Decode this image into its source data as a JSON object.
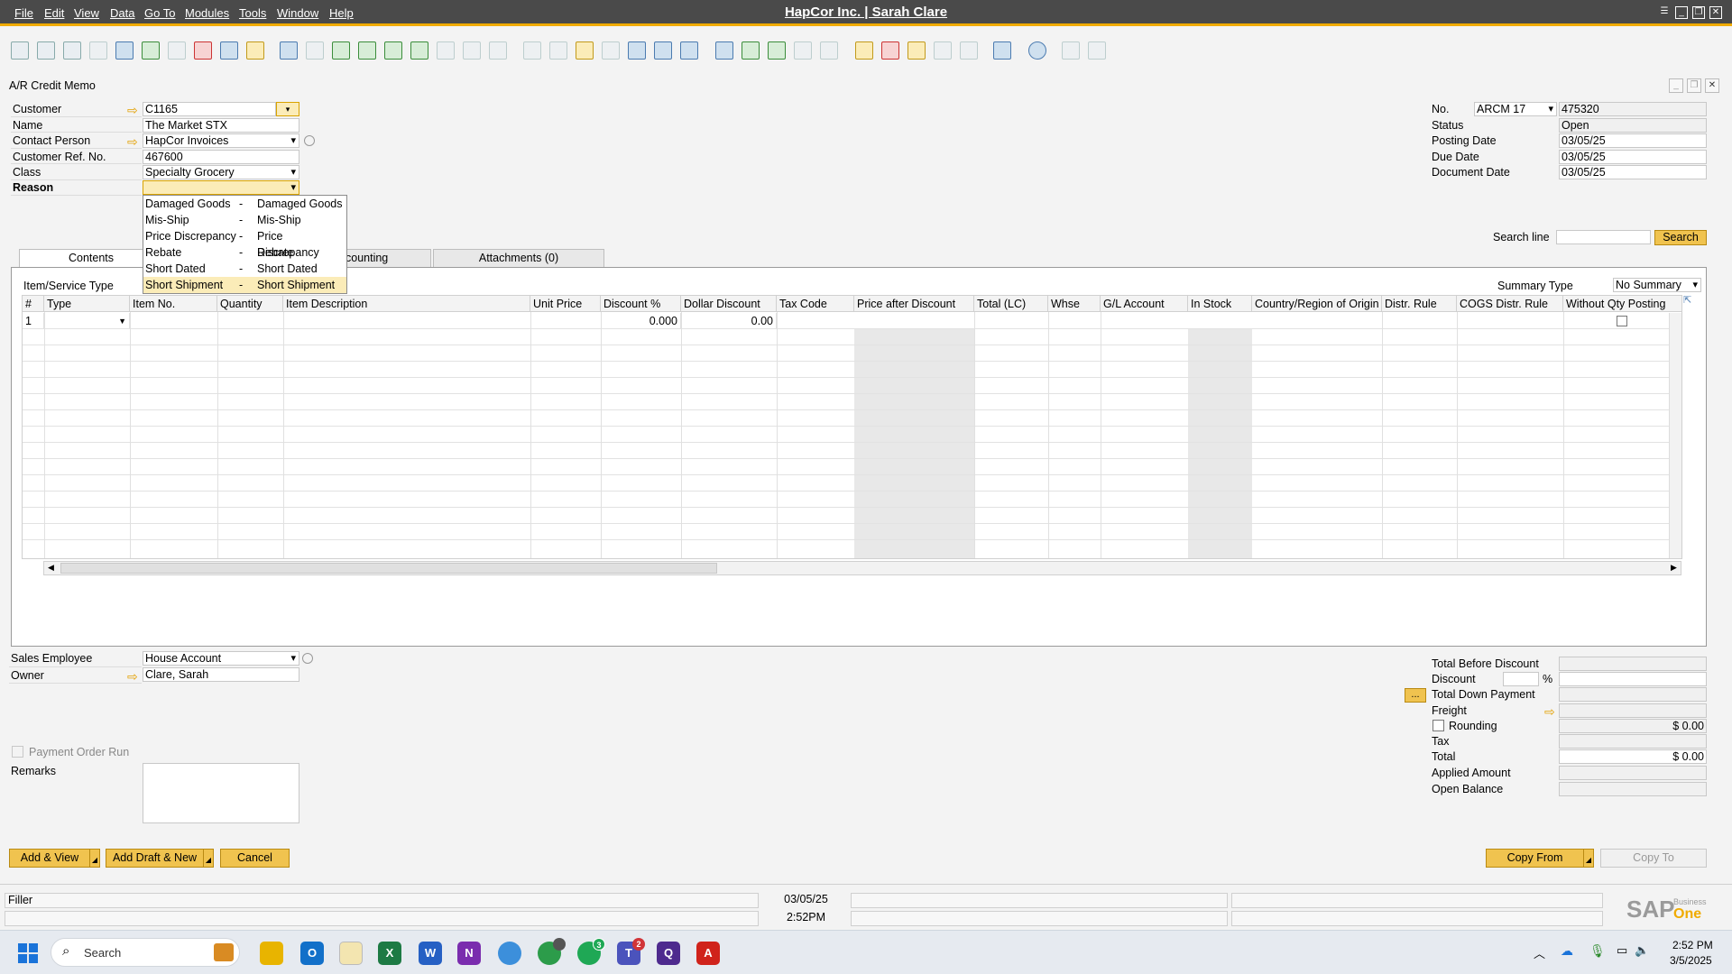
{
  "app": {
    "title": "HapCor Inc. | Sarah Clare",
    "menu": [
      "File",
      "Edit",
      "View",
      "Data",
      "Go To",
      "Modules",
      "Tools",
      "Window",
      "Help"
    ]
  },
  "window": {
    "title": "A/R Credit Memo"
  },
  "header_left": {
    "labels": {
      "customer": "Customer",
      "name": "Name",
      "contact": "Contact Person",
      "ref": "Customer Ref. No.",
      "class": "Class",
      "reason": "Reason"
    },
    "values": {
      "customer": "C1165",
      "name": "The Market STX",
      "contact": "HapCor Invoices",
      "ref": "467600",
      "class": "Specialty Grocery",
      "reason": ""
    }
  },
  "reason_options": [
    {
      "code": "Damaged Goods",
      "name": "Damaged Goods",
      "sep": "-"
    },
    {
      "code": "Mis-Ship",
      "name": "Mis-Ship",
      "sep": "-"
    },
    {
      "code": "Price Discrepancy",
      "name": "Price Discrepancy",
      "sep": "-"
    },
    {
      "code": "Rebate",
      "name": "Rebate",
      "sep": "-"
    },
    {
      "code": "Short Dated",
      "name": "Short Dated",
      "sep": "-"
    },
    {
      "code": "Short Shipment",
      "name": "Short Shipment",
      "sep": "-"
    }
  ],
  "header_right": {
    "labels": {
      "no": "No.",
      "status": "Status",
      "posting": "Posting Date",
      "due": "Due Date",
      "doc": "Document Date"
    },
    "values": {
      "series": "ARCM 17",
      "no": "475320",
      "status": "Open",
      "posting": "03/05/25",
      "due": "03/05/25",
      "doc": "03/05/25"
    }
  },
  "search": {
    "label": "Search line",
    "button": "Search",
    "value": ""
  },
  "tabs": [
    "Contents",
    "counting",
    "Attachments (0)"
  ],
  "contents": {
    "item_service_type": "Item/Service Type",
    "summary_type_label": "Summary Type",
    "summary_type_value": "No Summary"
  },
  "grid": {
    "columns": [
      "#",
      "Type",
      "Item No.",
      "Quantity",
      "Item Description",
      "Unit Price",
      "Discount %",
      "Dollar Discount",
      "Tax Code",
      "Price after Discount",
      "Total (LC)",
      "Whse",
      "G/L Account",
      "In Stock",
      "Country/Region of Origin",
      "Distr. Rule",
      "COGS Distr. Rule",
      "Without Qty Posting"
    ],
    "row1": {
      "num": "1",
      "discount_pct": "0.000",
      "dollar_discount": "0.00"
    }
  },
  "footer_left": {
    "sales_employee_label": "Sales Employee",
    "sales_employee": "House Account",
    "owner_label": "Owner",
    "owner": "Clare, Sarah",
    "payment_order_run": "Payment Order Run",
    "remarks_label": "Remarks"
  },
  "totals": {
    "labels": {
      "before": "Total Before Discount",
      "discount": "Discount",
      "pct": "%",
      "down": "Total Down Payment",
      "freight": "Freight",
      "rounding": "Rounding",
      "tax": "Tax",
      "total": "Total",
      "applied": "Applied Amount",
      "open": "Open Balance"
    },
    "values": {
      "rounding": "$ 0.00",
      "total": "$ 0.00"
    },
    "more_button": "..."
  },
  "buttons": {
    "add_view": "Add & View",
    "add_draft": "Add Draft & New",
    "cancel": "Cancel",
    "copy_from": "Copy From",
    "copy_to": "Copy To"
  },
  "statusbar": {
    "filler": "Filler",
    "date": "03/05/25",
    "time": "2:52PM",
    "brand": "SAP",
    "brand_sub": "Business",
    "brand_one": "One"
  },
  "taskbar": {
    "search": "Search",
    "time": "2:52 PM",
    "date": "3/5/2025",
    "badges": {
      "chrome": "",
      "whatsapp": "3",
      "teams": "2"
    }
  }
}
